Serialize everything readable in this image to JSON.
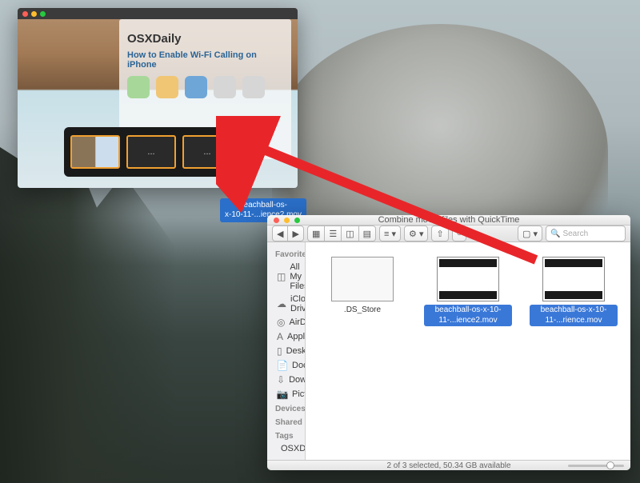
{
  "qt": {
    "overlay_logo": "OSXDaily",
    "overlay_headline": "How to Enable Wi-Fi Calling on iPhone",
    "clip_placeholder": "..."
  },
  "drag_tip": {
    "line1": "beachball-os-",
    "line2": "x-10-11-...ience2.mov"
  },
  "finder": {
    "title": "Combine movie files with QuickTime",
    "search_placeholder": "Search",
    "sidebar": {
      "heading_fav": "Favorites",
      "items": [
        {
          "label": "All My Files",
          "icon": "all-files-icon"
        },
        {
          "label": "iCloud Drive",
          "icon": "icloud-icon"
        },
        {
          "label": "AirDrop",
          "icon": "airdrop-icon"
        },
        {
          "label": "Applications",
          "icon": "applications-icon"
        },
        {
          "label": "Desktop",
          "icon": "desktop-icon"
        },
        {
          "label": "Documents",
          "icon": "documents-icon"
        },
        {
          "label": "Downloads",
          "icon": "downloads-icon"
        },
        {
          "label": "Pictures",
          "icon": "pictures-icon"
        }
      ],
      "heading_dev": "Devices",
      "heading_shared": "Shared",
      "heading_tags": "Tags",
      "tag_label": "OSXDaily.com"
    },
    "files": [
      {
        "name": ".DS_Store",
        "selected": false,
        "type": "doc"
      },
      {
        "name": "beachball-os-x-10-11-...ience2.mov",
        "selected": true,
        "type": "video"
      },
      {
        "name": "beachball-os-x-10-11-...rience.mov",
        "selected": true,
        "type": "video"
      }
    ],
    "status": "2 of 3 selected, 50.34 GB available"
  }
}
